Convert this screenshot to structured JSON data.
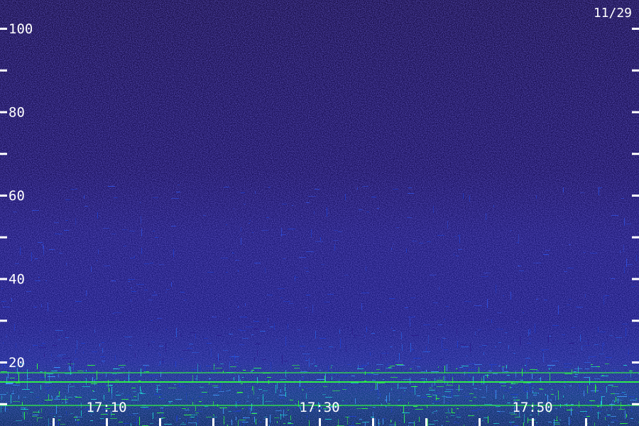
{
  "chart_data": {
    "type": "heatmap",
    "title": "",
    "date_label": "11/29",
    "xlabel": "",
    "ylabel": "",
    "y_axis": {
      "ticks": [
        20,
        40,
        60,
        80,
        100
      ],
      "labels": [
        "20",
        "40",
        "60",
        "80",
        "100"
      ],
      "minor_ticks": [
        10,
        30,
        50,
        70,
        90
      ],
      "range": [
        0,
        110
      ]
    },
    "x_axis": {
      "ticks": [
        "17:10",
        "17:30",
        "17:50"
      ],
      "minor_tick_count": 12,
      "range": [
        "17:05",
        "17:55"
      ]
    },
    "intensity_profile": [
      {
        "y_range": [
          0,
          6
        ],
        "level": "high"
      },
      {
        "y_range": [
          6,
          14
        ],
        "level": "medium-high"
      },
      {
        "y_range": [
          14,
          20
        ],
        "level": "medium"
      },
      {
        "y_range": [
          20,
          45
        ],
        "level": "low-medium"
      },
      {
        "y_range": [
          45,
          60
        ],
        "level": "low"
      },
      {
        "y_range": [
          60,
          110
        ],
        "level": "very-low"
      }
    ],
    "grid": false,
    "colors": {
      "background": "#000000",
      "low": "#2a1a8a",
      "medium": "#2040d0",
      "high": "#20d0d0",
      "peak": "#30ff40",
      "axis": "#ffffff"
    }
  }
}
